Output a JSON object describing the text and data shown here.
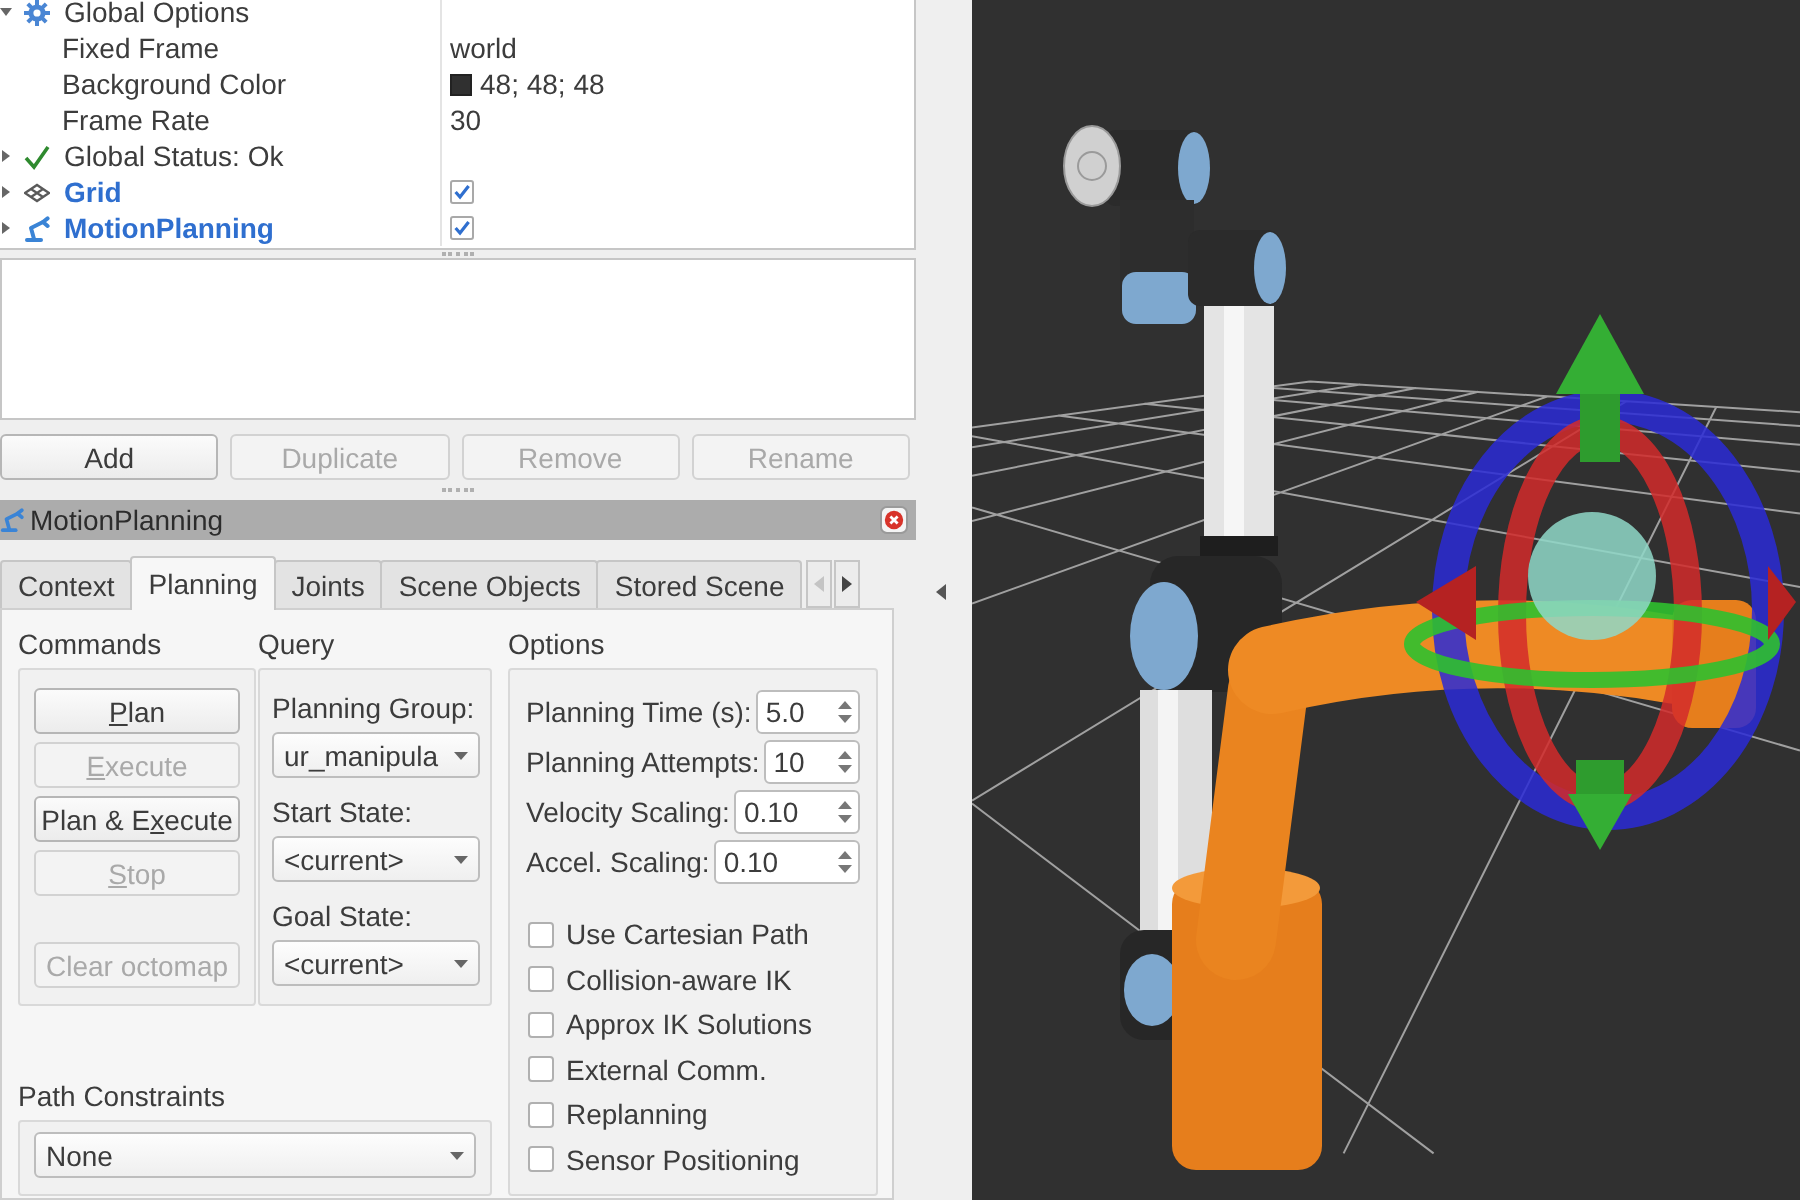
{
  "displays": [
    {
      "kind": "options",
      "label": "Global Options",
      "expanded": true,
      "children": [
        {
          "label": "Fixed Frame",
          "value": "world"
        },
        {
          "label": "Background Color",
          "value": "48; 48; 48",
          "color": "#303030"
        },
        {
          "label": "Frame Rate",
          "value": "30"
        }
      ]
    },
    {
      "kind": "status",
      "label": "Global Status: Ok",
      "expanded": false
    },
    {
      "kind": "grid",
      "label": "Grid",
      "expanded": false,
      "checked": true
    },
    {
      "kind": "motion_planning",
      "label": "MotionPlanning",
      "expanded": false,
      "checked": true
    }
  ],
  "display_buttons": [
    {
      "label": "Add",
      "disabled": false
    },
    {
      "label": "Duplicate",
      "disabled": true
    },
    {
      "label": "Remove",
      "disabled": true
    },
    {
      "label": "Rename",
      "disabled": true
    }
  ],
  "panel": {
    "title": "MotionPlanning",
    "tabs": [
      {
        "label": "Context",
        "selected": false
      },
      {
        "label": "Planning",
        "selected": true
      },
      {
        "label": "Joints",
        "selected": false
      },
      {
        "label": "Scene Objects",
        "selected": false
      },
      {
        "label": "Stored Scene",
        "selected": false
      }
    ],
    "tab_scroll": {
      "back_disabled": true,
      "forward_disabled": false
    },
    "commands": {
      "title": "Commands",
      "buttons": [
        {
          "label_parts": [
            {
              "text": "P",
              "underlined": true
            },
            {
              "text": "lan",
              "underlined": false
            }
          ],
          "disabled": false
        },
        {
          "label_parts": [
            {
              "text": "E",
              "underlined": true
            },
            {
              "text": "xecute",
              "underlined": false
            }
          ],
          "disabled": true
        },
        {
          "label_parts": [
            {
              "text": "Plan & E",
              "underlined": false
            },
            {
              "text": "x",
              "underlined": true
            },
            {
              "text": "ecute",
              "underlined": false
            }
          ],
          "disabled": false
        },
        {
          "label_parts": [
            {
              "text": "S",
              "underlined": true
            },
            {
              "text": "top",
              "underlined": false
            }
          ],
          "disabled": true
        },
        {
          "label_parts": [
            {
              "text": "Clear octomap",
              "underlined": false
            }
          ],
          "disabled": true
        }
      ]
    },
    "query": {
      "title": "Query",
      "fields": [
        {
          "label": "Planning Group:",
          "value": "ur_manipula"
        },
        {
          "label": "Start State:",
          "value": "<current>"
        },
        {
          "label": "Goal State:",
          "value": "<current>"
        }
      ]
    },
    "options": {
      "title": "Options",
      "spinners": [
        {
          "label": "Planning Time (s):",
          "value": "5.0"
        },
        {
          "label": "Planning Attempts:",
          "value": "10"
        },
        {
          "label": "Velocity Scaling:",
          "value": "0.10"
        },
        {
          "label": "Accel. Scaling:",
          "value": "0.10"
        }
      ],
      "checkboxes": [
        {
          "label": "Use Cartesian Path",
          "checked": false
        },
        {
          "label": "Collision-aware IK",
          "checked": false
        },
        {
          "label": "Approx IK Solutions",
          "checked": false
        },
        {
          "label": "External Comm.",
          "checked": false
        },
        {
          "label": "Replanning",
          "checked": false
        },
        {
          "label": "Sensor Positioning",
          "checked": false
        }
      ]
    },
    "path_constraints": {
      "title": "Path Constraints",
      "value": "None"
    }
  }
}
